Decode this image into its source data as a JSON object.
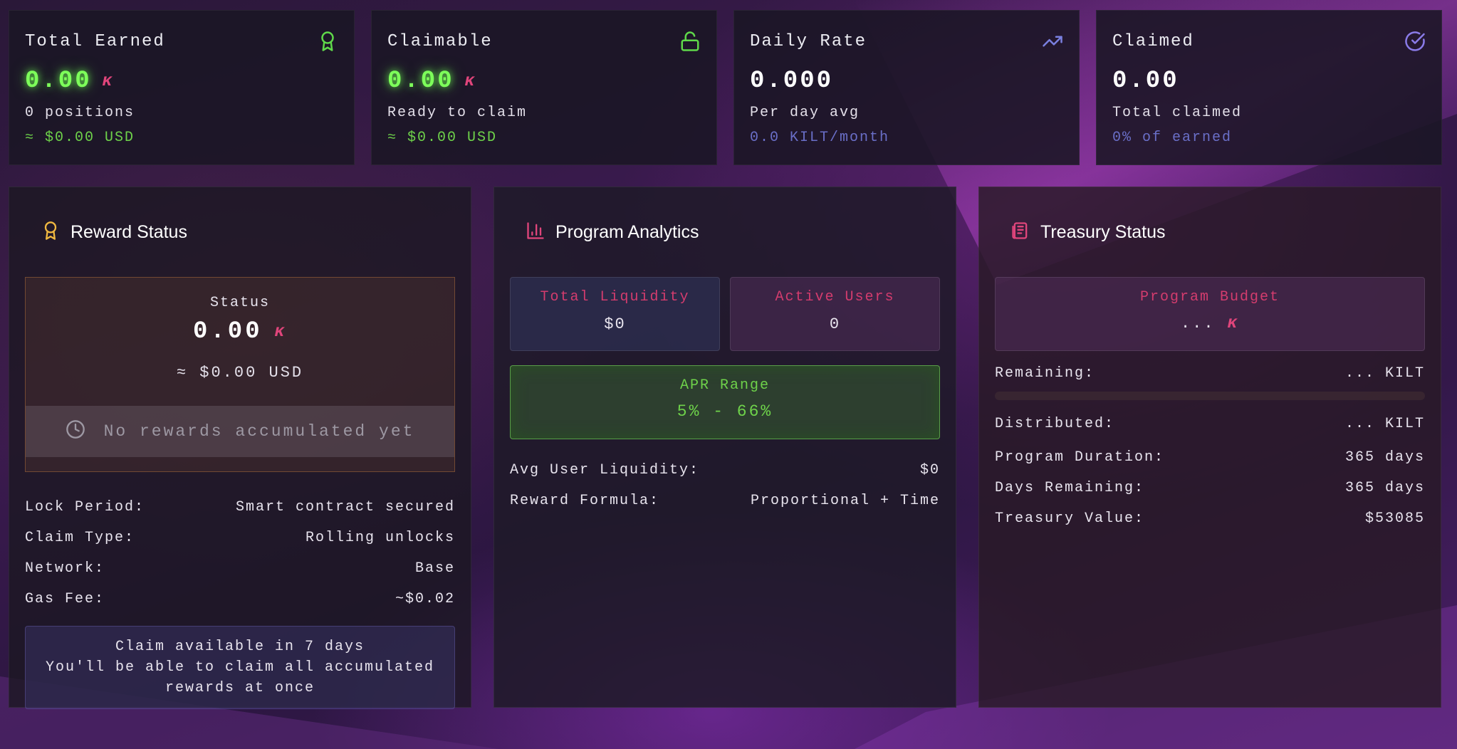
{
  "colors": {
    "accent_green": "#7dff5a",
    "accent_pink": "#e0457b",
    "accent_blue": "#6a6fc8",
    "warning_gold": "#f0b840"
  },
  "stats": [
    {
      "title": "Total Earned",
      "icon": "award-icon",
      "value": "0.00",
      "show_kilt": true,
      "sub": "0 positions",
      "foot": "≈ $0.00 USD"
    },
    {
      "title": "Claimable",
      "icon": "unlock-icon",
      "value": "0.00",
      "show_kilt": true,
      "sub": "Ready to claim",
      "foot": "≈ $0.00 USD"
    },
    {
      "title": "Daily Rate",
      "icon": "trending-up-icon",
      "value": "0.000",
      "show_kilt": false,
      "sub": "Per day avg",
      "foot": "0.0 KILT/month"
    },
    {
      "title": "Claimed",
      "icon": "check-circle-icon",
      "value": "0.00",
      "show_kilt": false,
      "sub": "Total claimed",
      "foot": "0% of earned"
    }
  ],
  "reward_status": {
    "title": "Reward Status",
    "status_label": "Status",
    "status_value": "0.00",
    "status_usd": "≈ $0.00 USD",
    "empty_message": "No rewards accumulated yet",
    "details": [
      {
        "label": "Lock Period:",
        "value": "Smart contract secured"
      },
      {
        "label": "Claim Type:",
        "value": "Rolling unlocks"
      },
      {
        "label": "Network:",
        "value": "Base"
      },
      {
        "label": "Gas Fee:",
        "value": "~$0.02"
      }
    ],
    "notice_line1": "Claim available in 7 days",
    "notice_line2": "You'll be able to claim all accumulated rewards at once"
  },
  "program_analytics": {
    "title": "Program Analytics",
    "total_liquidity_label": "Total Liquidity",
    "total_liquidity_value": "$0",
    "active_users_label": "Active Users",
    "active_users_value": "0",
    "apr_label": "APR Range",
    "apr_value": "5% - 66%",
    "details": [
      {
        "label": "Avg User Liquidity:",
        "value": "$0"
      },
      {
        "label": "Reward Formula:",
        "value": "Proportional + Time"
      }
    ]
  },
  "treasury_status": {
    "title": "Treasury Status",
    "budget_label": "Program Budget",
    "budget_value": "...",
    "remaining_label": "Remaining:",
    "remaining_value": "... KILT",
    "remaining_progress": 0,
    "distributed_label": "Distributed:",
    "distributed_value": "... KILT",
    "details": [
      {
        "label": "Program Duration:",
        "value": "365 days"
      },
      {
        "label": "Days Remaining:",
        "value": "365 days"
      },
      {
        "label": "Treasury Value:",
        "value": "$53085"
      }
    ]
  }
}
